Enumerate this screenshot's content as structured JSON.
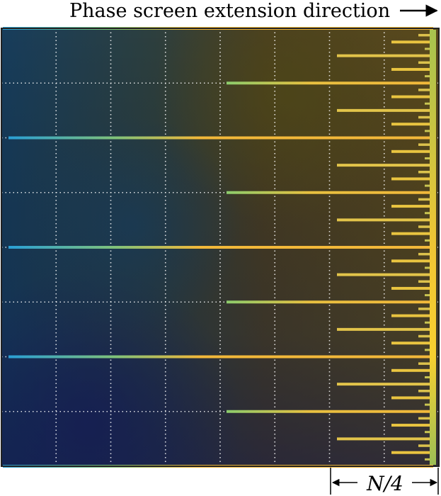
{
  "title": "Phase screen extension direction",
  "scale_label": "N/4",
  "colors": {
    "background_low": "#1b3a5a",
    "background_mid": "#4b3d20",
    "background_high": "#5e4a1e",
    "stripe_cold": "#2a9fd6",
    "stripe_mid": "#7fc27a",
    "stripe_warm": "#f2b83a",
    "grid": "#ffffff",
    "frame": "#222222"
  }
}
